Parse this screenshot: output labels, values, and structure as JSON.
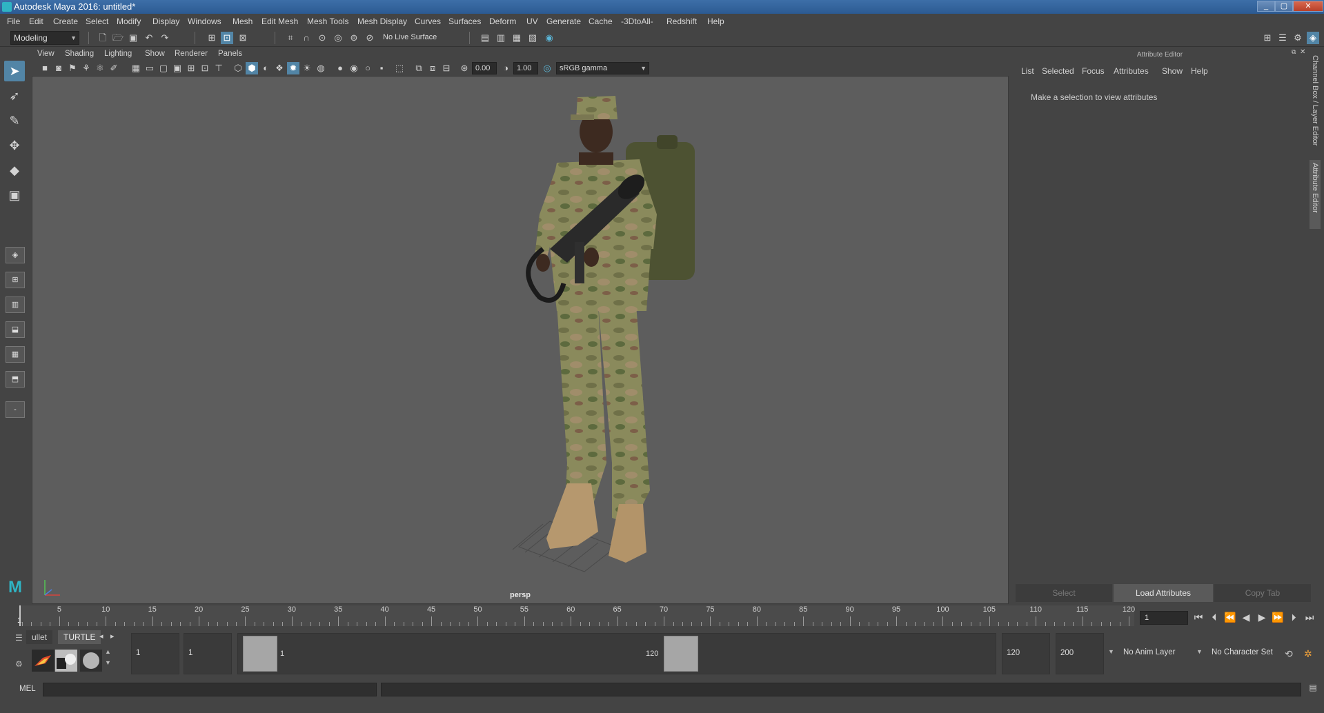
{
  "window": {
    "title": "Autodesk Maya 2016: untitled*"
  },
  "menubar": [
    "File",
    "Edit",
    "Create",
    "Select",
    "Modify",
    "Display",
    "Windows",
    "Mesh",
    "Edit Mesh",
    "Mesh Tools",
    "Mesh Display",
    "Curves",
    "Surfaces",
    "Deform",
    "UV",
    "Generate",
    "Cache",
    "-3DtoAll-",
    "Redshift",
    "Help"
  ],
  "statusline": {
    "menuset": "Modeling",
    "live_surface": "No Live Surface"
  },
  "viewport": {
    "menu": [
      "View",
      "Shading",
      "Lighting",
      "Show",
      "Renderer",
      "Panels"
    ],
    "exposure": "0.00",
    "gamma": "1.00",
    "color_space": "sRGB gamma",
    "camera_label": "persp"
  },
  "attribute_editor": {
    "header": "Attribute Editor",
    "menu": [
      "List",
      "Selected",
      "Focus",
      "Attributes",
      "Show",
      "Help"
    ],
    "message": "Make a selection to view attributes",
    "buttons": {
      "select": "Select",
      "load": "Load Attributes",
      "copy": "Copy Tab"
    },
    "side_tabs": {
      "channel_box": "Channel Box / Layer Editor",
      "attribute_editor": "Attribute Editor"
    }
  },
  "timeslider": {
    "ticks": [
      "5",
      "10",
      "15",
      "20",
      "25",
      "30",
      "35",
      "40",
      "45",
      "50",
      "55",
      "60",
      "65",
      "70",
      "75",
      "80",
      "85",
      "90",
      "95",
      "100",
      "105",
      "110",
      "115",
      "120"
    ],
    "current_frame_marker": "1",
    "current_frame": "1"
  },
  "shelf": {
    "tabs": [
      "ullet",
      "TURTLE"
    ]
  },
  "range": {
    "start_time": "1",
    "playback_start": "1",
    "slider_start": "1",
    "slider_end": "120",
    "playback_end": "120",
    "end_time": "200",
    "anim_layer": "No Anim Layer",
    "character_set": "No Character Set"
  },
  "cmdline": {
    "label": "MEL"
  },
  "icons": [
    "select-tool-icon",
    "lasso-tool-icon",
    "paint-select-icon",
    "move-tool-icon",
    "rotate-tool-icon",
    "scale-tool-icon"
  ]
}
